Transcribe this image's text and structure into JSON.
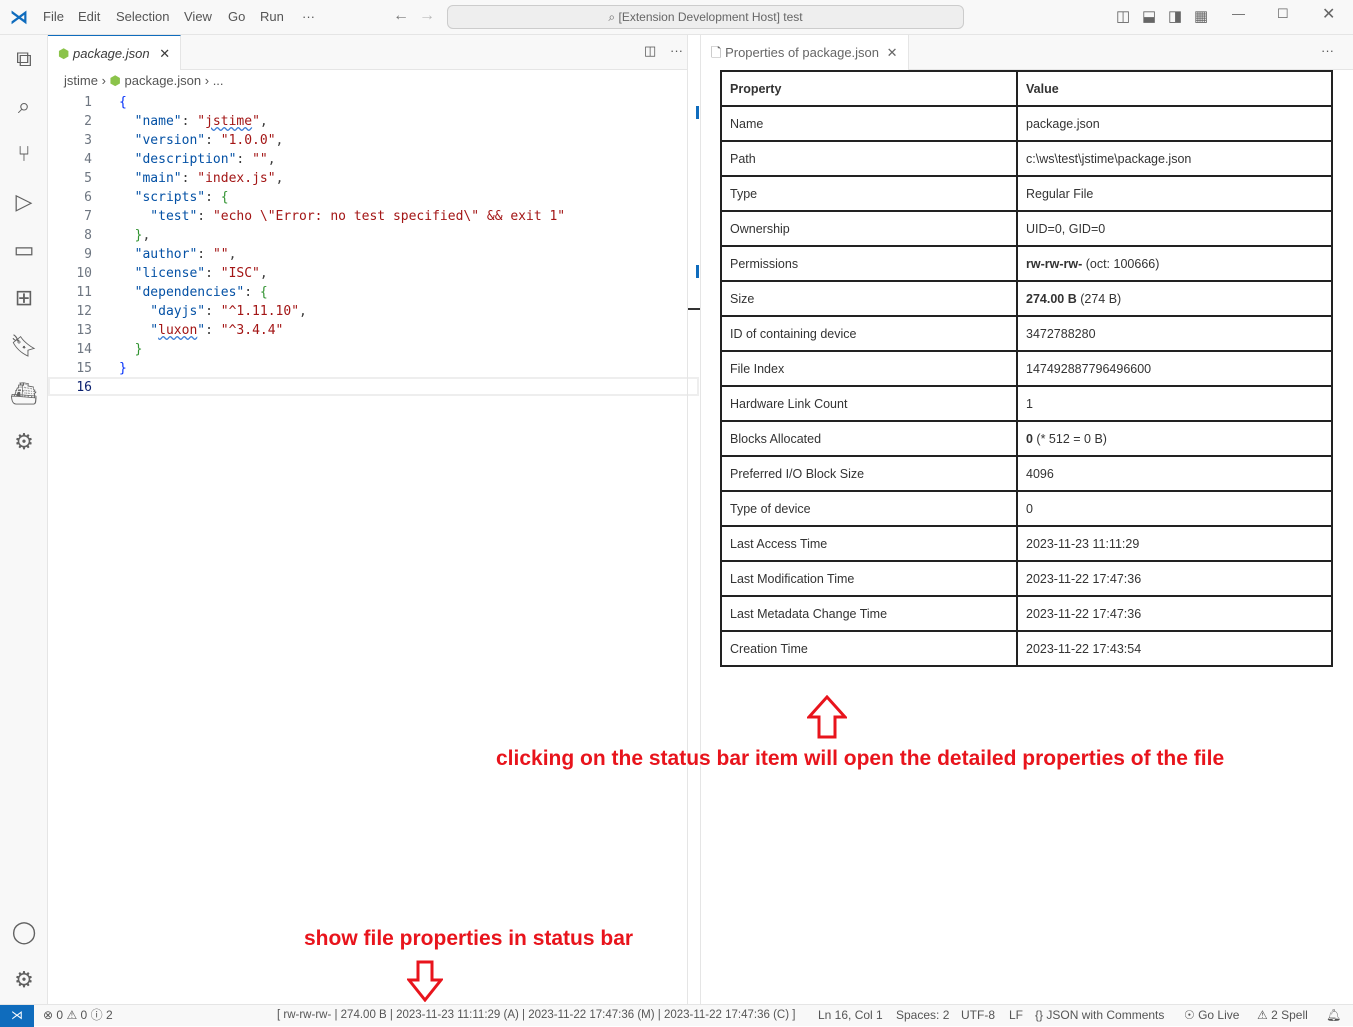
{
  "titlebar": {
    "menus": [
      "File",
      "Edit",
      "Selection",
      "View",
      "Go",
      "Run",
      "···"
    ],
    "search": "[Extension Development Host] test"
  },
  "editor": {
    "tab": "package.json",
    "breadcrumb": [
      "jstime",
      "package.json",
      "..."
    ],
    "lines": [
      [
        [
          "b",
          "{"
        ]
      ],
      [
        [
          "k",
          "  \"name\""
        ],
        [
          "p",
          ": "
        ],
        [
          "s",
          "\""
        ],
        [
          "sq",
          "jstime"
        ],
        [
          "s",
          "\""
        ],
        [
          "p",
          ","
        ]
      ],
      [
        [
          "k",
          "  \"version\""
        ],
        [
          "p",
          ": "
        ],
        [
          "s",
          "\"1.0.0\""
        ],
        [
          "p",
          ","
        ]
      ],
      [
        [
          "k",
          "  \"description\""
        ],
        [
          "p",
          ": "
        ],
        [
          "s",
          "\"\""
        ],
        [
          "p",
          ","
        ]
      ],
      [
        [
          "k",
          "  \"main\""
        ],
        [
          "p",
          ": "
        ],
        [
          "s",
          "\"index.js\""
        ],
        [
          "p",
          ","
        ]
      ],
      [
        [
          "k",
          "  \"scripts\""
        ],
        [
          "p",
          ": "
        ],
        [
          "b2",
          "{"
        ]
      ],
      [
        [
          "k",
          "    \"test\""
        ],
        [
          "p",
          ": "
        ],
        [
          "s",
          "\"echo \\\"Error: no test specified\\\" && exit 1\""
        ]
      ],
      [
        [
          "b2",
          "  }"
        ],
        [
          "p",
          ","
        ]
      ],
      [
        [
          "k",
          "  \"author\""
        ],
        [
          "p",
          ": "
        ],
        [
          "s",
          "\"\""
        ],
        [
          "p",
          ","
        ]
      ],
      [
        [
          "k",
          "  \"license\""
        ],
        [
          "p",
          ": "
        ],
        [
          "s",
          "\"ISC\""
        ],
        [
          "p",
          ","
        ]
      ],
      [
        [
          "k",
          "  \"dependencies\""
        ],
        [
          "p",
          ": "
        ],
        [
          "b2",
          "{"
        ]
      ],
      [
        [
          "k",
          "    \"dayjs\""
        ],
        [
          "p",
          ": "
        ],
        [
          "s",
          "\"^1.11.10\""
        ],
        [
          "p",
          ","
        ]
      ],
      [
        [
          "k",
          "    \""
        ],
        [
          "sq",
          "luxon"
        ],
        [
          "k",
          "\""
        ],
        [
          "p",
          ": "
        ],
        [
          "s",
          "\"^3.4.4\""
        ]
      ],
      [
        [
          "b2",
          "  }"
        ]
      ],
      [
        [
          "b",
          "}"
        ]
      ],
      []
    ]
  },
  "properties": {
    "tab": "Properties of package.json",
    "headers": [
      "Property",
      "Value"
    ],
    "rows": [
      [
        "Name",
        "package.json",
        ""
      ],
      [
        "Path",
        "c:\\ws\\test\\jstime\\package.json",
        ""
      ],
      [
        "Type",
        "Regular File",
        ""
      ],
      [
        "Ownership",
        "UID=0, GID=0",
        ""
      ],
      [
        "Permissions",
        "rw-rw-rw-",
        " (oct: 100666)"
      ],
      [
        "Size",
        "274.00 B",
        " (274 B)"
      ],
      [
        "ID of containing device",
        "3472788280",
        ""
      ],
      [
        "File Index",
        "147492887796496600",
        ""
      ],
      [
        "Hardware Link Count",
        "1",
        ""
      ],
      [
        "Blocks Allocated",
        "0",
        " (* 512 = 0 B)"
      ],
      [
        "Preferred I/O Block Size",
        "4096",
        ""
      ],
      [
        "Type of device",
        "0",
        ""
      ],
      [
        "Last Access Time",
        "2023-11-23 11:11:29",
        ""
      ],
      [
        "Last Modification Time",
        "2023-11-22 17:47:36",
        ""
      ],
      [
        "Last Metadata Change Time",
        "2023-11-22 17:47:36",
        ""
      ],
      [
        "Creation Time",
        "2023-11-22 17:43:54",
        ""
      ]
    ],
    "bold_rows": [
      4,
      5,
      9
    ]
  },
  "annotations": {
    "top": "clicking on the status bar item will open the detailed properties of the file",
    "bottom": "show file properties in status bar"
  },
  "statusbar": {
    "errors": "0",
    "warnings": "0",
    "info": "2",
    "file_props": "[ rw-rw-rw- | 274.00 B | 2023-11-23 11:11:29 (A) | 2023-11-22 17:47:36 (M) | 2023-11-22 17:47:36 (C) ]",
    "position": "Ln 16, Col 1",
    "spaces": "Spaces: 2",
    "encoding": "UTF-8",
    "eol": "LF",
    "language": "JSON with Comments",
    "golive": "Go Live",
    "spell": "2 Spell"
  },
  "colors": {
    "accent": "#0f6cbd",
    "annotation": "#e8141c"
  }
}
